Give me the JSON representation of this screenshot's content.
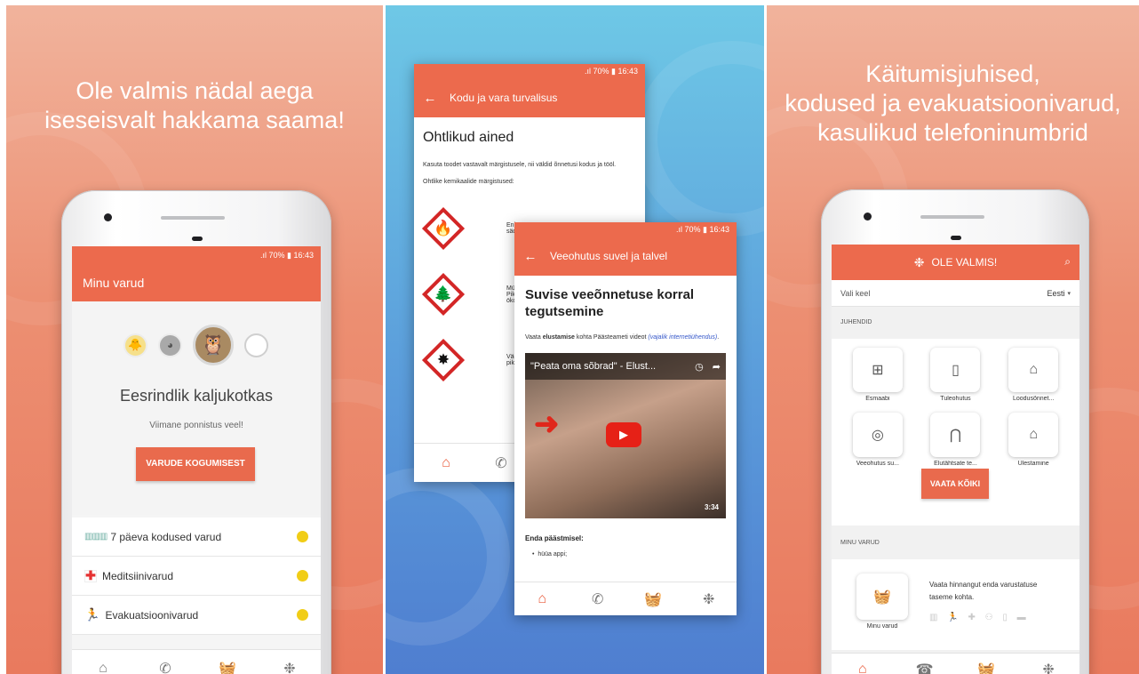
{
  "panel1": {
    "headline_line1": "Ole valmis nädal aega",
    "headline_line2": "iseseisvalt hakkama saama!",
    "status": ".ıl 70% ▮ 16:43",
    "appbar_title": "Minu varud",
    "level_title": "Eesrindlik kaljukotkas",
    "level_subtitle": "Viimane ponnistus veel!",
    "button_label": "VARUDE KOGUMISEST",
    "list": [
      {
        "label": "7 päeva kodused varud",
        "icon": "water-bottles-icon"
      },
      {
        "label": "Meditsiinivarud",
        "icon": "medical-cross-icon"
      },
      {
        "label": "Evakuatsioonivarud",
        "icon": "running-person-icon"
      }
    ],
    "status_dot_color": "#f1cd16"
  },
  "panel2": {
    "back_card": {
      "status": ".ıl 70% ▮ 16:43",
      "appbar_title": "Kodu ja vara turvalisus",
      "heading": "Ohtlikud ained",
      "para1": "Kasuta toodet vastavalt märgistusele, nii väldid õnnetusi kodus ja tööl.",
      "para2": "Ohtlike kemikaalide märgistused:",
      "hazard1_text": "Enl sädi",
      "hazard2_text": "Mür Pika öko",
      "hazard3_text": "Väg pike"
    },
    "front_card": {
      "status": ".ıl 70% ▮ 16:43",
      "appbar_title": "Veeohutus suvel ja talvel",
      "heading": "Suvise veeõnnetuse korral tegutsemine",
      "intro_prefix": "Vaata ",
      "intro_bold": "elustamise",
      "intro_mid": " kohta Päästeameti videot ",
      "intro_link": "(vajalik internetiühendus)",
      "intro_suffix": ".",
      "video_title": "\"Peata oma sõbrad\" - Elust...",
      "video_duration": "3:34",
      "subheading": "Enda päästmisel:",
      "bullet1": "hüüa appi;"
    }
  },
  "panel3": {
    "headline_line1": "Käitumisjuhised,",
    "headline_line2": "kodused ja evakuatsioonivarud,",
    "headline_line3": "kasulikud telefoninumbrid",
    "app_title": "OLE VALMIS!",
    "lang_label": "Vali keel",
    "lang_value": "Eesti",
    "section_guides": "JUHENDID",
    "tiles": [
      {
        "label": "Esmaabi",
        "icon": "first-aid-kit-icon"
      },
      {
        "label": "Tuleohutus",
        "icon": "fire-extinguisher-icon"
      },
      {
        "label": "Loodusõnnet...",
        "icon": "flood-house-icon"
      },
      {
        "label": "Veeohutus su...",
        "icon": "lifebuoy-icon"
      },
      {
        "label": "Elutähtsate te...",
        "icon": "water-tap-icon"
      },
      {
        "label": "Ülestamine",
        "icon": "shelter-icon"
      }
    ],
    "see_all_label": "VAATA KÕIKI",
    "section_supplies": "MINU VARUD",
    "supplies_tile_label": "Minu varud",
    "supplies_text": "Vaata hinnangut enda varustatuse taseme kohta."
  },
  "colors": {
    "coral": "#ec6a4d",
    "nav_active": "#e95a3a",
    "hazard_red": "#d32626",
    "link_blue": "#3456c9"
  }
}
